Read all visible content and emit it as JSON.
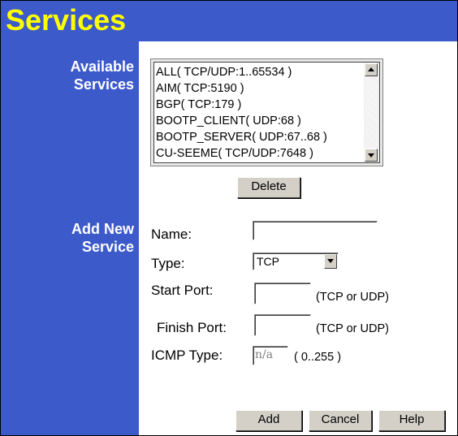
{
  "header": {
    "title": "Services"
  },
  "sidebar": {
    "available_label_1": "Available",
    "available_label_2": "Services",
    "add_label_1": "Add New",
    "add_label_2": "Service"
  },
  "available_services": {
    "items": [
      "ALL( TCP/UDP:1..65534 )",
      "AIM( TCP:5190 )",
      "BGP( TCP:179 )",
      "BOOTP_CLIENT( UDP:68 )",
      "BOOTP_SERVER( UDP:67..68 )",
      "CU-SEEME( TCP/UDP:7648 )"
    ],
    "delete_label": "Delete"
  },
  "form": {
    "name_label": "Name:",
    "name_value": "",
    "type_label": "Type:",
    "type_value": "TCP",
    "start_port_label": "Start Port:",
    "start_port_value": "",
    "start_port_hint": "(TCP or UDP)",
    "finish_port_label": "Finish Port:",
    "finish_port_value": "",
    "finish_port_hint": "(TCP or UDP)",
    "icmp_label": "ICMP Type:",
    "icmp_value": "n/a",
    "icmp_hint": "( 0..255 )"
  },
  "buttons": {
    "add": "Add",
    "cancel": "Cancel",
    "help": "Help"
  },
  "colors": {
    "header_bg": "#3d5acb",
    "title": "#ffff00",
    "sidebar_text": "#ffffff"
  },
  "icons": {
    "scroll_up": "triangle-up-icon",
    "scroll_down": "triangle-down-icon",
    "dropdown": "triangle-down-icon"
  }
}
